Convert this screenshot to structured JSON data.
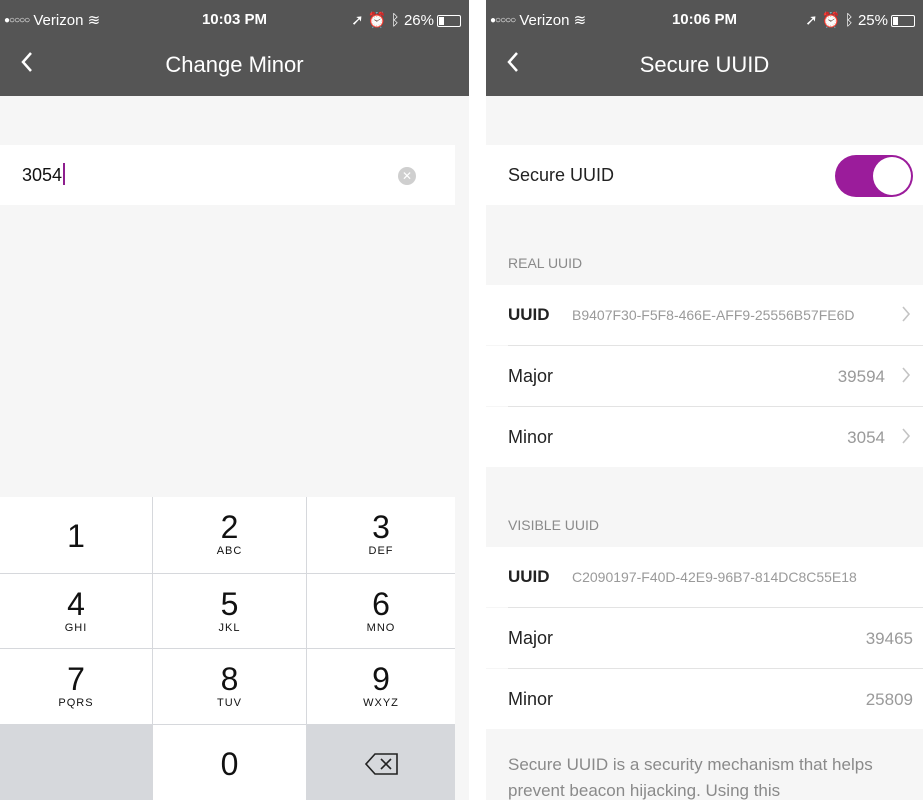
{
  "left": {
    "status": {
      "carrier": "Verizon",
      "time": "10:03 PM",
      "battery": "26%",
      "battery_level": 0.26
    },
    "nav": {
      "back_icon": "chevron-left-icon",
      "title": "Change Minor"
    },
    "input": {
      "value": "3054",
      "clear_icon": "clear-circle-icon"
    },
    "keypad": {
      "keys": [
        {
          "num": "1",
          "letters": ""
        },
        {
          "num": "2",
          "letters": "ABC"
        },
        {
          "num": "3",
          "letters": "DEF"
        },
        {
          "num": "4",
          "letters": "GHI"
        },
        {
          "num": "5",
          "letters": "JKL"
        },
        {
          "num": "6",
          "letters": "MNO"
        },
        {
          "num": "7",
          "letters": "PQRS"
        },
        {
          "num": "8",
          "letters": "TUV"
        },
        {
          "num": "9",
          "letters": "WXYZ"
        },
        {
          "num": "0",
          "letters": ""
        }
      ],
      "delete_icon": "backspace-icon"
    }
  },
  "right": {
    "status": {
      "carrier": "Verizon",
      "time": "10:06 PM",
      "battery": "25%",
      "battery_level": 0.25
    },
    "nav": {
      "back_icon": "chevron-left-icon",
      "title": "Secure UUID"
    },
    "secure_toggle": {
      "label": "Secure UUID",
      "on": true,
      "accent": "#9b1c9b"
    },
    "real": {
      "header": "REAL UUID",
      "uuid_label": "UUID",
      "uuid_value": "B9407F30-F5F8-466E-AFF9-25556B57FE6D",
      "major_label": "Major",
      "major_value": "39594",
      "minor_label": "Minor",
      "minor_value": "3054"
    },
    "visible": {
      "header": "VISIBLE UUID",
      "uuid_label": "UUID",
      "uuid_value": "C2090197-F40D-42E9-96B7-814DC8C55E18",
      "major_label": "Major",
      "major_value": "39465",
      "minor_label": "Minor",
      "minor_value": "25809"
    },
    "footnote": "Secure UUID is a security mechanism that helps prevent beacon hijacking. Using this"
  }
}
